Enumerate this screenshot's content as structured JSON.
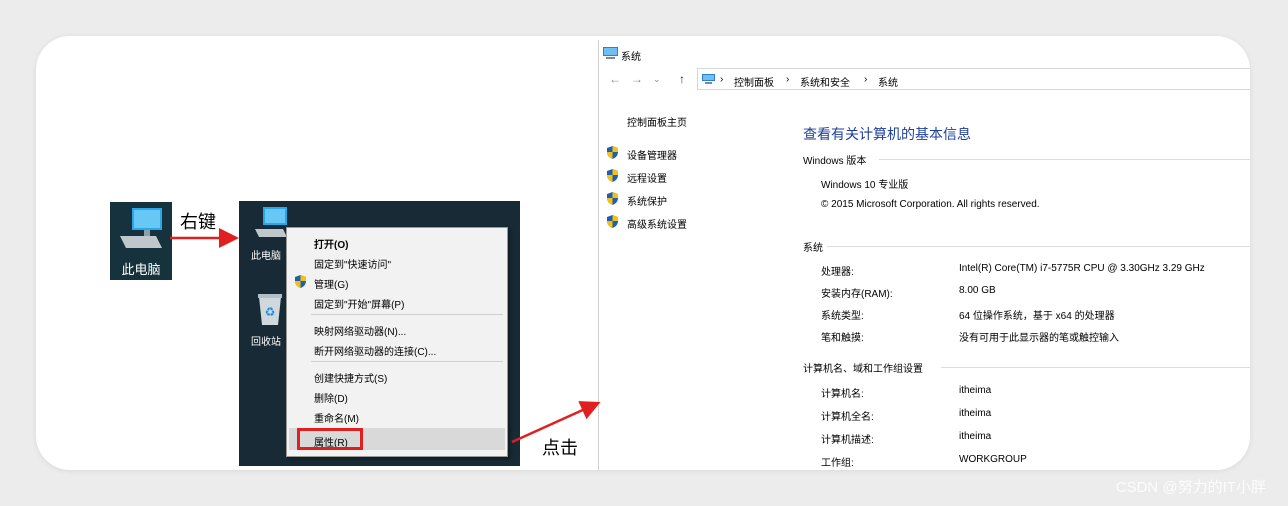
{
  "desktop_icon": {
    "label": "此电脑",
    "icon": "computer-icon"
  },
  "step1_label": "右键",
  "step2_label": "点击",
  "desktop_screenshot": {
    "icons": [
      {
        "label": "此电脑",
        "icon": "computer-icon"
      },
      {
        "label": "回收站",
        "icon": "recycle-bin-icon"
      }
    ],
    "context_menu": {
      "items": [
        {
          "label": "打开(O)",
          "bold": true
        },
        {
          "label": "固定到\"快速访问\""
        },
        {
          "label": "管理(G)",
          "icon": "shield-icon"
        },
        {
          "label": "固定到\"开始\"屏幕(P)"
        },
        {
          "label": "映射网络驱动器(N)..."
        },
        {
          "label": "断开网络驱动器的连接(C)..."
        },
        {
          "label": "创建快捷方式(S)"
        },
        {
          "label": "删除(D)"
        },
        {
          "label": "重命名(M)"
        },
        {
          "label": "属性(R)",
          "highlighted": true
        }
      ]
    }
  },
  "system_window": {
    "title": "系统",
    "breadcrumb": [
      "控制面板",
      "系统和安全",
      "系统"
    ],
    "left_nav": {
      "home": "控制面板主页",
      "links": [
        "设备管理器",
        "远程设置",
        "系统保护",
        "高级系统设置"
      ]
    },
    "heading": "查看有关计算机的基本信息",
    "windows_edition": {
      "header": "Windows 版本",
      "edition": "Windows 10 专业版",
      "copyright": "© 2015 Microsoft Corporation. All rights reserved."
    },
    "system": {
      "header": "系统",
      "rows": [
        {
          "label": "处理器:",
          "value": "Intel(R) Core(TM) i7-5775R CPU @ 3.30GHz   3.29 GHz"
        },
        {
          "label": "安装内存(RAM):",
          "value": "8.00 GB"
        },
        {
          "label": "系统类型:",
          "value": "64 位操作系统，基于 x64 的处理器"
        },
        {
          "label": "笔和触摸:",
          "value": "没有可用于此显示器的笔或触控输入"
        }
      ]
    },
    "computer_name": {
      "header": "计算机名、域和工作组设置",
      "rows": [
        {
          "label": "计算机名:",
          "value": "itheima"
        },
        {
          "label": "计算机全名:",
          "value": "itheima"
        },
        {
          "label": "计算机描述:",
          "value": "itheima"
        },
        {
          "label": "工作组:",
          "value": "WORKGROUP"
        }
      ]
    }
  },
  "watermark": "CSDN @努力的IT小胖",
  "colors": {
    "accent_red": "#e02020",
    "link_blue": "#1e3f9a",
    "desktop_bg": "#172a35"
  }
}
